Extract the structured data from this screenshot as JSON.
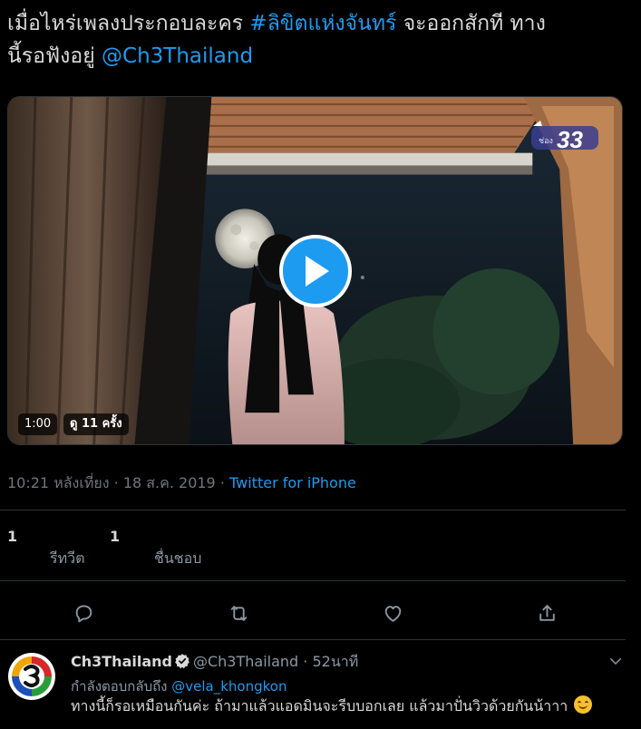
{
  "tweet": {
    "text_part1": "เมื่อไหร่เพลงประกอบละคร ",
    "hashtag": "#ลิขิตแห่งจันทร์",
    "text_part2": " จะออกสักที ทาง",
    "text_line2": "นี้รอฟังอยู่ ",
    "mention": "@Ch3Thailand"
  },
  "video": {
    "duration": "1:00",
    "views": "ดู 11 ครั้ง",
    "channel_badge_prefix": "ช่อง",
    "channel_badge_number": "33"
  },
  "meta": {
    "time": "10:21 หลังเที่ยง",
    "separator": "·",
    "date": "18 ส.ค. 2019",
    "source": "Twitter for iPhone"
  },
  "stats": {
    "retweets_count": "1",
    "retweets_label": "รีทวีต",
    "likes_count": "1",
    "likes_label": "ชื่นชอบ"
  },
  "actions": [
    "reply-icon",
    "retweet-icon",
    "like-icon",
    "share-icon"
  ],
  "reply": {
    "name": "Ch3Thailand",
    "handle": "@Ch3Thailand",
    "separator": "·",
    "time": "52นาที",
    "replying_to_label": "กำลังตอบกลับถึง ",
    "replying_to_handle": "@vela_khongkon",
    "body": "ทางนี้ก็รอเหมือนกันค่ะ ถ้ามาแล้วแอดมินจะรีบบอกเลย แล้วมาปั่นวิวด้วยกันน้าาา "
  },
  "colors": {
    "background": "#000000",
    "link": "#1d9bf0",
    "muted": "#8b98a5",
    "divider": "#2f3336"
  }
}
